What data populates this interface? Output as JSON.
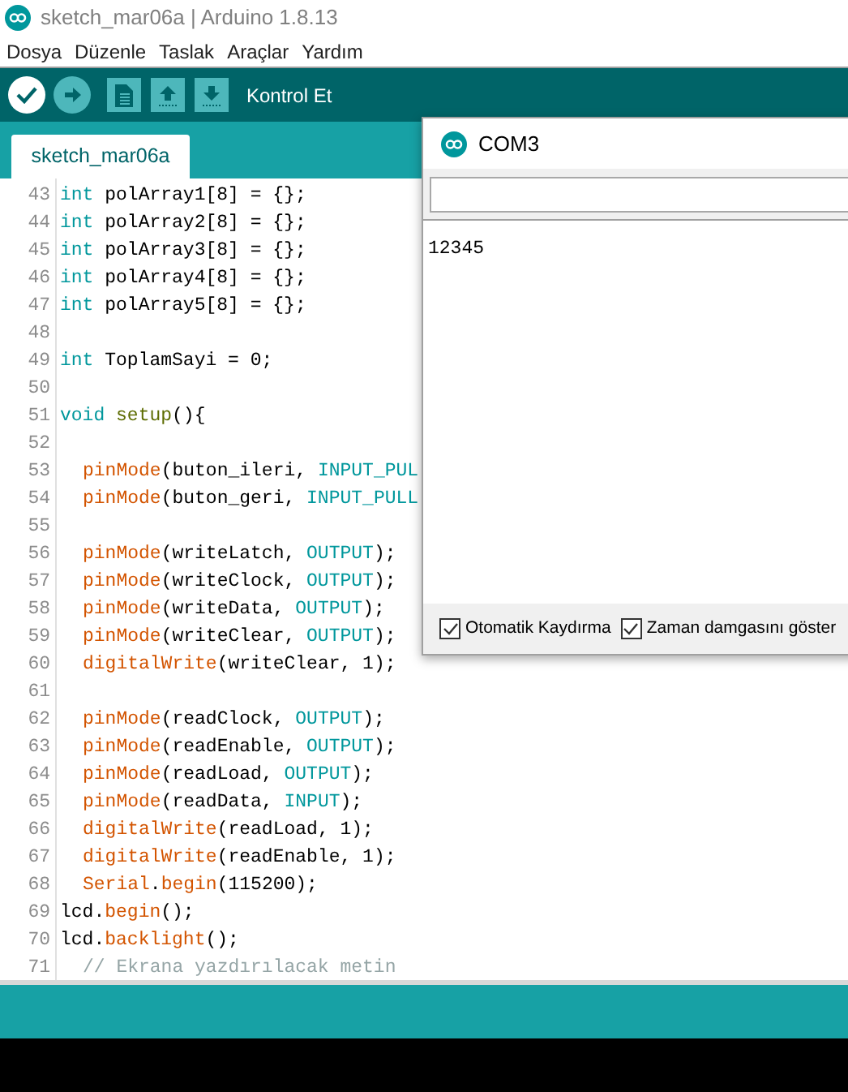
{
  "window": {
    "title": "sketch_mar06a | Arduino 1.8.13"
  },
  "menu": [
    "Dosya",
    "Düzenle",
    "Taslak",
    "Araçlar",
    "Yardım"
  ],
  "toolbar": {
    "status": "Kontrol Et",
    "buttons": [
      {
        "kind": "verify"
      },
      {
        "kind": "upload"
      },
      {
        "kind": "new"
      },
      {
        "kind": "open"
      },
      {
        "kind": "save"
      }
    ]
  },
  "tabs": [
    {
      "label": "sketch_mar06a",
      "selected": true
    }
  ],
  "editor": {
    "lines": [
      {
        "number": "43",
        "indented": false,
        "tokens": [
          {
            "kind": "type",
            "text": "int"
          },
          {
            "kind": "plain",
            "text": " polArray1[8] = {};"
          }
        ]
      },
      {
        "number": "44",
        "indented": false,
        "tokens": [
          {
            "kind": "type",
            "text": "int"
          },
          {
            "kind": "plain",
            "text": " polArray2[8] = {};"
          }
        ]
      },
      {
        "number": "45",
        "indented": false,
        "tokens": [
          {
            "kind": "type",
            "text": "int"
          },
          {
            "kind": "plain",
            "text": " polArray3[8] = {};"
          }
        ]
      },
      {
        "number": "46",
        "indented": false,
        "tokens": [
          {
            "kind": "type",
            "text": "int"
          },
          {
            "kind": "plain",
            "text": " polArray4[8] = {};"
          }
        ]
      },
      {
        "number": "47",
        "indented": false,
        "tokens": [
          {
            "kind": "type",
            "text": "int"
          },
          {
            "kind": "plain",
            "text": " polArray5[8] = {};"
          }
        ]
      },
      {
        "number": "48"
      },
      {
        "number": "49",
        "indented": false,
        "tokens": [
          {
            "kind": "type",
            "text": "int"
          },
          {
            "kind": "plain",
            "text": " ToplamSayi = 0;"
          }
        ]
      },
      {
        "number": "50"
      },
      {
        "number": "51",
        "indented": false,
        "tokens": [
          {
            "kind": "type",
            "text": "void "
          },
          {
            "kind": "structure",
            "text": "setup"
          },
          {
            "kind": "plain",
            "text": "(){"
          }
        ]
      },
      {
        "number": "52"
      },
      {
        "number": "53",
        "indented": true,
        "tokens": [
          {
            "kind": "function",
            "text": "pinMode"
          },
          {
            "kind": "plain",
            "text": "(buton_ileri, "
          },
          {
            "kind": "constant",
            "text": "INPUT_PUL"
          }
        ]
      },
      {
        "number": "54",
        "indented": true,
        "tokens": [
          {
            "kind": "function",
            "text": "pinMode"
          },
          {
            "kind": "plain",
            "text": "(buton_geri, "
          },
          {
            "kind": "constant",
            "text": "INPUT_PULL"
          }
        ]
      },
      {
        "number": "55"
      },
      {
        "number": "56",
        "indented": true,
        "tokens": [
          {
            "kind": "function",
            "text": "pinMode"
          },
          {
            "kind": "plain",
            "text": "(writeLatch, "
          },
          {
            "kind": "constant",
            "text": "OUTPUT"
          },
          {
            "kind": "plain",
            "text": ");"
          }
        ]
      },
      {
        "number": "57",
        "indented": true,
        "tokens": [
          {
            "kind": "function",
            "text": "pinMode"
          },
          {
            "kind": "plain",
            "text": "(writeClock, "
          },
          {
            "kind": "constant",
            "text": "OUTPUT"
          },
          {
            "kind": "plain",
            "text": ");"
          }
        ]
      },
      {
        "number": "58",
        "indented": true,
        "tokens": [
          {
            "kind": "function",
            "text": "pinMode"
          },
          {
            "kind": "plain",
            "text": "(writeData, "
          },
          {
            "kind": "constant",
            "text": "OUTPUT"
          },
          {
            "kind": "plain",
            "text": ");"
          }
        ]
      },
      {
        "number": "59",
        "indented": true,
        "tokens": [
          {
            "kind": "function",
            "text": "pinMode"
          },
          {
            "kind": "plain",
            "text": "(writeClear, "
          },
          {
            "kind": "constant",
            "text": "OUTPUT"
          },
          {
            "kind": "plain",
            "text": ");"
          }
        ]
      },
      {
        "number": "60",
        "indented": true,
        "tokens": [
          {
            "kind": "function",
            "text": "digitalWrite"
          },
          {
            "kind": "plain",
            "text": "(writeClear, 1);"
          }
        ]
      },
      {
        "number": "61"
      },
      {
        "number": "62",
        "indented": true,
        "tokens": [
          {
            "kind": "function",
            "text": "pinMode"
          },
          {
            "kind": "plain",
            "text": "(readClock, "
          },
          {
            "kind": "constant",
            "text": "OUTPUT"
          },
          {
            "kind": "plain",
            "text": ");"
          }
        ]
      },
      {
        "number": "63",
        "indented": true,
        "tokens": [
          {
            "kind": "function",
            "text": "pinMode"
          },
          {
            "kind": "plain",
            "text": "(readEnable, "
          },
          {
            "kind": "constant",
            "text": "OUTPUT"
          },
          {
            "kind": "plain",
            "text": ");"
          }
        ]
      },
      {
        "number": "64",
        "indented": true,
        "tokens": [
          {
            "kind": "function",
            "text": "pinMode"
          },
          {
            "kind": "plain",
            "text": "(readLoad, "
          },
          {
            "kind": "constant",
            "text": "OUTPUT"
          },
          {
            "kind": "plain",
            "text": ");"
          }
        ]
      },
      {
        "number": "65",
        "indented": true,
        "tokens": [
          {
            "kind": "function",
            "text": "pinMode"
          },
          {
            "kind": "plain",
            "text": "(readData, "
          },
          {
            "kind": "constant",
            "text": "INPUT"
          },
          {
            "kind": "plain",
            "text": ");"
          }
        ]
      },
      {
        "number": "66",
        "indented": true,
        "tokens": [
          {
            "kind": "function",
            "text": "digitalWrite"
          },
          {
            "kind": "plain",
            "text": "(readLoad, 1);"
          }
        ]
      },
      {
        "number": "67",
        "indented": true,
        "tokens": [
          {
            "kind": "function",
            "text": "digitalWrite"
          },
          {
            "kind": "plain",
            "text": "(readEnable, 1);"
          }
        ]
      },
      {
        "number": "68",
        "indented": true,
        "tokens": [
          {
            "kind": "function",
            "text": "Serial"
          },
          {
            "kind": "plain",
            "text": "."
          },
          {
            "kind": "function",
            "text": "begin"
          },
          {
            "kind": "plain",
            "text": "(115200);"
          }
        ]
      },
      {
        "number": "69",
        "indented": false,
        "tokens": [
          {
            "kind": "plain",
            "text": "lcd."
          },
          {
            "kind": "function",
            "text": "begin"
          },
          {
            "kind": "plain",
            "text": "();"
          }
        ]
      },
      {
        "number": "70",
        "indented": false,
        "tokens": [
          {
            "kind": "plain",
            "text": "lcd."
          },
          {
            "kind": "function",
            "text": "backlight"
          },
          {
            "kind": "plain",
            "text": "();"
          }
        ]
      },
      {
        "number": "71",
        "indented": true,
        "tokens": [
          {
            "kind": "comment",
            "text": "// Ekrana yazdırılacak metin"
          }
        ]
      }
    ]
  },
  "serial_monitor": {
    "title": "COM3",
    "output": "12345",
    "options": [
      {
        "label": "Otomatik Kaydırma",
        "checked": true
      },
      {
        "label": "Zaman damgasını göster",
        "checked": true
      }
    ]
  }
}
